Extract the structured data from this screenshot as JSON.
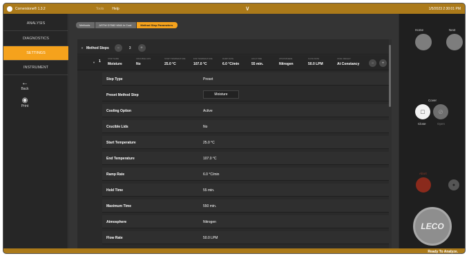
{
  "app": {
    "title": "Cornerstone® 1.3.2",
    "menu": [
      "Tools",
      "Help"
    ],
    "datetime": "1/5/2023 2:30:01 PM"
  },
  "nav": {
    "items": [
      {
        "label": "ANALYSIS",
        "active": false
      },
      {
        "label": "DIAGNOSTICS",
        "active": false
      },
      {
        "label": "SETTINGS",
        "active": true
      },
      {
        "label": "INSTRUMENT",
        "active": false
      }
    ],
    "back_label": "Back",
    "print_label": "Print"
  },
  "breadcrumbs": [
    "Methods",
    "ASTM D7582 MVA In Coal",
    "Method Step Parameters"
  ],
  "method_steps": {
    "label": "Method Steps",
    "count": "3",
    "step": {
      "number": "1",
      "columns": [
        {
          "header": "Step Name",
          "value": "Moisture"
        },
        {
          "header": "Crucible Lids",
          "value": "No"
        },
        {
          "header": "Start Temperature",
          "value": "25.0 °C"
        },
        {
          "header": "End Temperature",
          "value": "107.0 °C"
        },
        {
          "header": "Ramp Rate",
          "value": "6.0 °C/min"
        },
        {
          "header": "Hold Time",
          "value": "55 min."
        },
        {
          "header": "Atmosphere",
          "value": "Nitrogen"
        },
        {
          "header": "Flow Rate",
          "value": "50.0 LPM"
        },
        {
          "header": "Final Weight",
          "value": "At Constancy"
        }
      ]
    }
  },
  "parameters": [
    {
      "label": "Step Type",
      "value": "Preset"
    },
    {
      "label": "Preset Method Step",
      "value": "Moisture",
      "boxed": true
    },
    {
      "label": "Cooling Option",
      "value": "Active"
    },
    {
      "label": "Crucible Lids",
      "value": "No"
    },
    {
      "label": "Start Temperature",
      "value": "25.0 °C"
    },
    {
      "label": "End Temperature",
      "value": "107.0 °C"
    },
    {
      "label": "Ramp Rate",
      "value": "6.0 °C/min"
    },
    {
      "label": "Hold Time",
      "value": "55 min."
    },
    {
      "label": "Maximum Time",
      "value": "550 min."
    },
    {
      "label": "Atmosphere",
      "value": "Nitrogen"
    },
    {
      "label": "Flow Rate",
      "value": "50.0 LPM"
    }
  ],
  "right_panel": {
    "home_label": "Home",
    "next_label": "Next",
    "cover_label": "Cover",
    "close_label": "Close",
    "open_label": "Open",
    "abort_label": "Abort",
    "brand": "LECO"
  },
  "status": "Ready To Analyze.",
  "colors": {
    "accent": "#f5a21c",
    "titlebar": "#ab7a1a",
    "abort": "#8a2a1c"
  },
  "icons": [
    "app-logo-icon",
    "chevron-down-icon",
    "back-arrow-icon",
    "print-icon",
    "close-cover-icon",
    "open-cover-icon",
    "bell-icon"
  ]
}
